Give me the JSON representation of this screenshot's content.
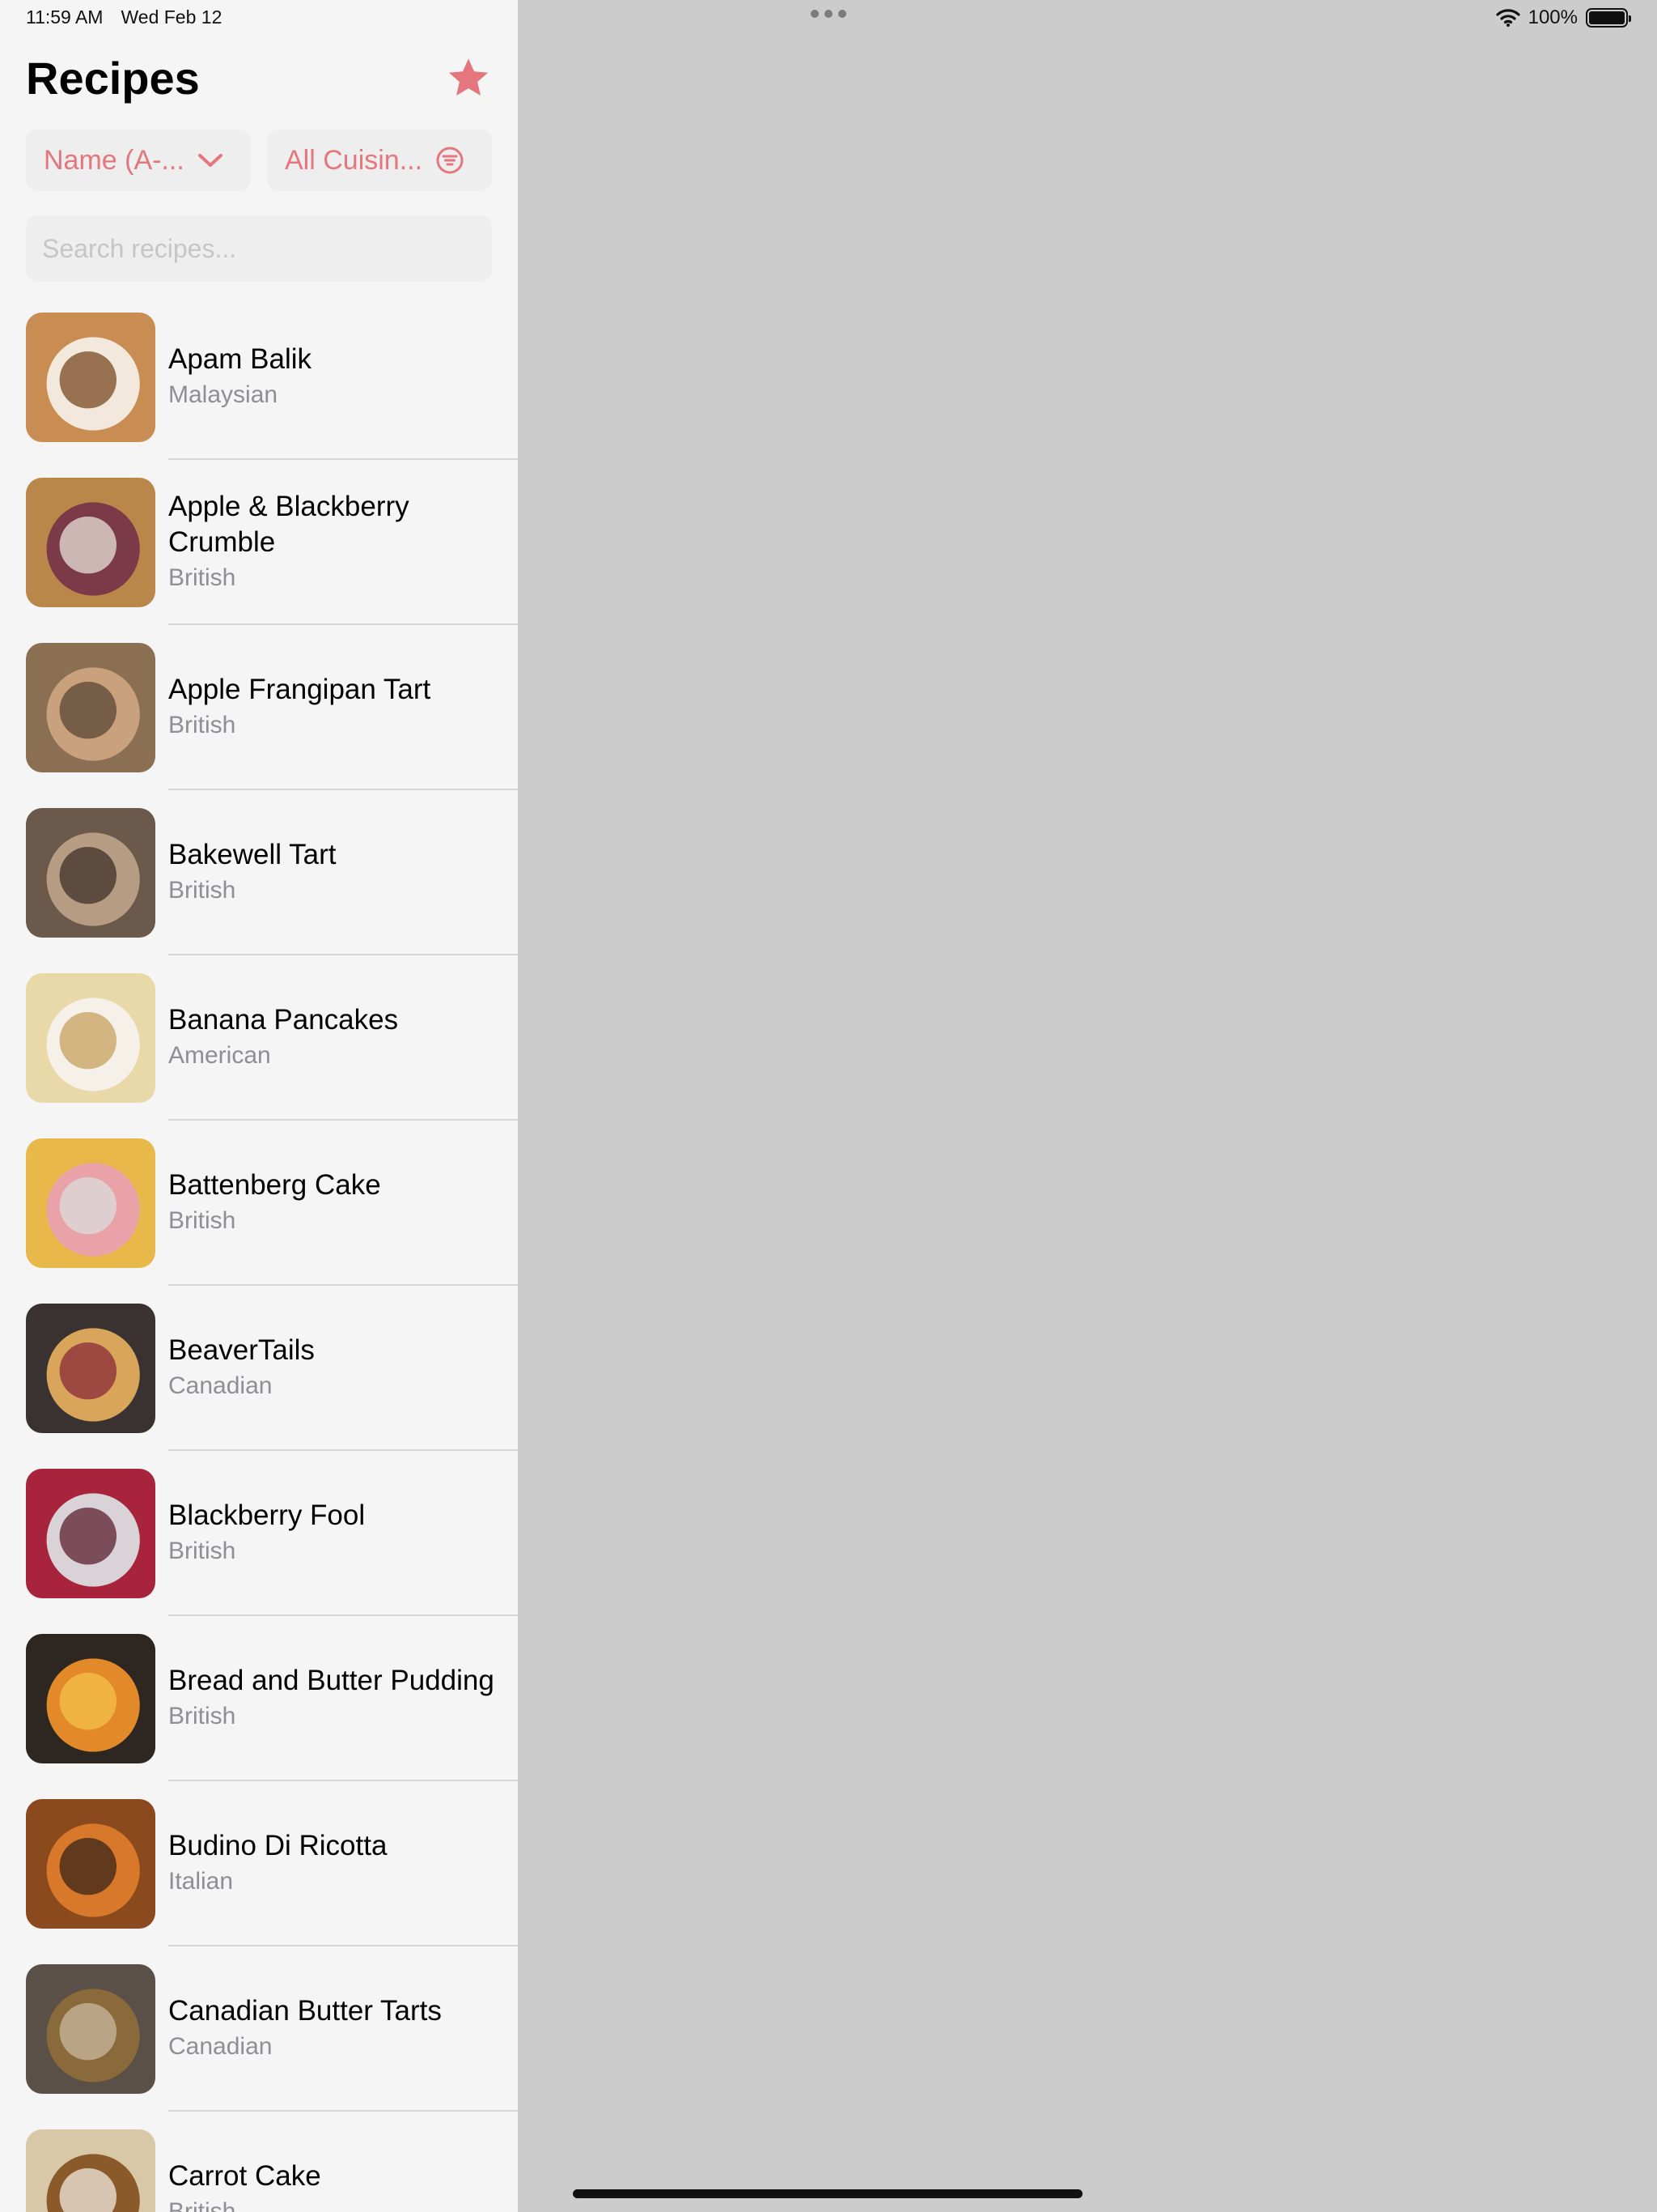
{
  "status_bar": {
    "time": "11:59 AM",
    "date": "Wed Feb 12",
    "battery": "100%"
  },
  "header": {
    "title": "Recipes",
    "favorites_icon": "star-icon"
  },
  "filters": {
    "sort_label": "Name (A-...",
    "cuisine_label": "All Cuisin..."
  },
  "search": {
    "placeholder": "Search recipes..."
  },
  "recipes": [
    {
      "name": "Apam Balik",
      "cuisine": "Malaysian"
    },
    {
      "name": "Apple & Blackberry Crumble",
      "cuisine": "British"
    },
    {
      "name": "Apple Frangipan Tart",
      "cuisine": "British"
    },
    {
      "name": "Bakewell Tart",
      "cuisine": "British"
    },
    {
      "name": "Banana Pancakes",
      "cuisine": "American"
    },
    {
      "name": "Battenberg Cake",
      "cuisine": "British"
    },
    {
      "name": "BeaverTails",
      "cuisine": "Canadian"
    },
    {
      "name": "Blackberry Fool",
      "cuisine": "British"
    },
    {
      "name": "Bread and Butter Pudding",
      "cuisine": "British"
    },
    {
      "name": "Budino Di Ricotta",
      "cuisine": "Italian"
    },
    {
      "name": "Canadian Butter Tarts",
      "cuisine": "Canadian"
    },
    {
      "name": "Carrot Cake",
      "cuisine": "British"
    }
  ],
  "colors": {
    "accent": "#e5767e",
    "secondary_text": "#8e8e93"
  }
}
